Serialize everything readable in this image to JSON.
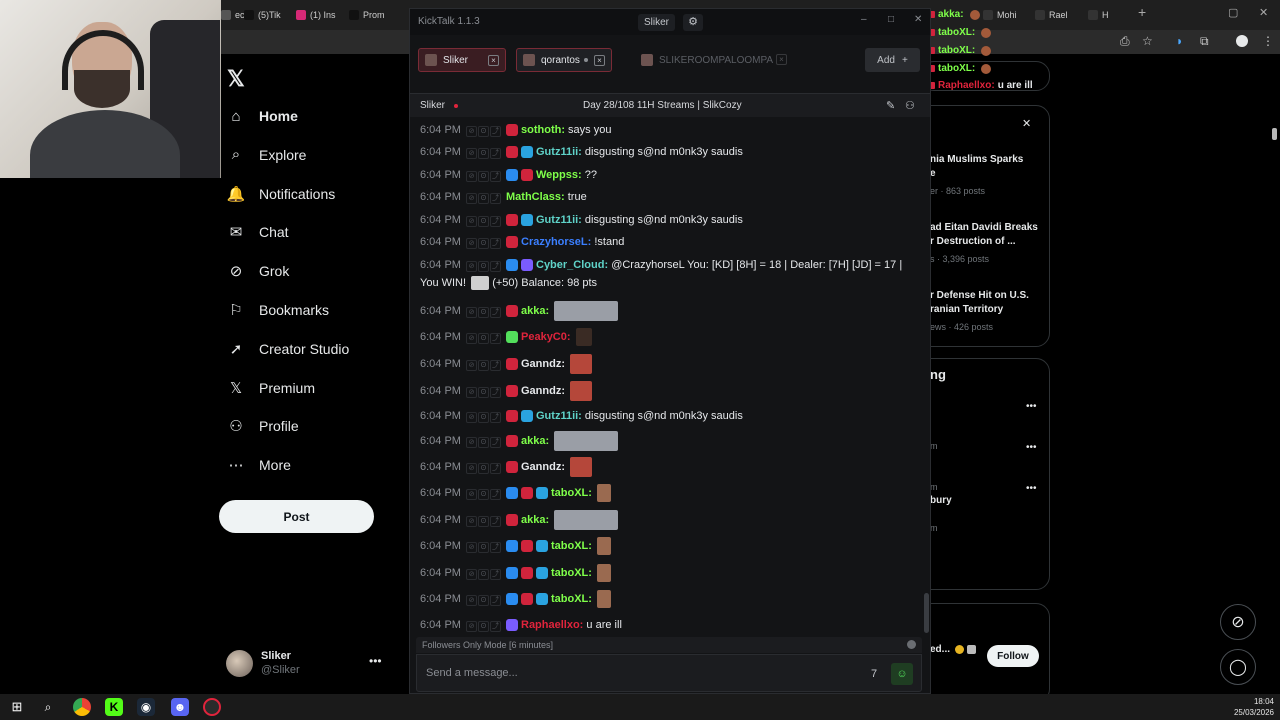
{
  "browser": {
    "tabs": [
      {
        "label": "ec",
        "color": "#555555"
      },
      {
        "label": "(5)Tik",
        "color": "#111111"
      },
      {
        "label": "(1) Ins",
        "color": "#d62976"
      },
      {
        "label": "Prom",
        "color": "#111111"
      },
      {
        "label": "Mohi",
        "color": "#333333"
      },
      {
        "label": "Rael",
        "color": "#333333"
      },
      {
        "label": "H",
        "color": "#333333"
      }
    ]
  },
  "x": {
    "nav": [
      {
        "label": "Home",
        "icon": "home-icon",
        "glyph": "⌂",
        "active": true
      },
      {
        "label": "Explore",
        "icon": "search-icon",
        "glyph": "⌕"
      },
      {
        "label": "Notifications",
        "icon": "bell-icon",
        "glyph": "🔔"
      },
      {
        "label": "Chat",
        "icon": "mail-icon",
        "glyph": "✉"
      },
      {
        "label": "Grok",
        "icon": "grok-icon",
        "glyph": "⊘"
      },
      {
        "label": "Bookmarks",
        "icon": "bookmark-icon",
        "glyph": "⚐"
      },
      {
        "label": "Creator Studio",
        "icon": "rocket-icon",
        "glyph": "➚"
      },
      {
        "label": "Premium",
        "icon": "x-logo-icon",
        "glyph": "𝕏"
      },
      {
        "label": "Profile",
        "icon": "person-icon",
        "glyph": "⚇"
      },
      {
        "label": "More",
        "icon": "more-circle-icon",
        "glyph": "⋯"
      }
    ],
    "post_label": "Post",
    "account": {
      "name": "Sliker",
      "handle": "@Sliker"
    },
    "news": [
      {
        "title": "nia Muslims Sparks",
        "title2": "e",
        "meta": "er · 863 posts"
      },
      {
        "title": "ad Eitan Davidi Breaks",
        "title2": "r Destruction of ...",
        "meta": "s · 3,396 posts"
      },
      {
        "title": "r Defense Hit on U.S.",
        "title2": "ranian Territory",
        "meta": "ews · 426 posts"
      }
    ],
    "trending_heading": "ng",
    "trend_items": [
      {
        "label": "m",
        "label2": ""
      },
      {
        "label": "m",
        "label2": "bury"
      },
      {
        "label": "m",
        "label2": ""
      }
    ],
    "suggestion": "ed...",
    "follow_label": "Follow",
    "close_glyph": "✕"
  },
  "overlay": [
    {
      "name": "akka:",
      "text": "",
      "color": "#7fff4a"
    },
    {
      "name": "taboXL:",
      "text": "",
      "color": "#7fff4a"
    },
    {
      "name": "taboXL:",
      "text": "",
      "color": "#7fff4a"
    },
    {
      "name": "taboXL:",
      "text": "",
      "color": "#7fff4a"
    },
    {
      "name": "Raphaellxo:",
      "text": "u are ill",
      "color": "#e0243c"
    }
  ],
  "kicktalk": {
    "app_title": "KickTalk 1.1.3",
    "user_button": "Sliker",
    "tabs": [
      {
        "label": "Sliker",
        "active": true,
        "live": false
      },
      {
        "label": "qorantos",
        "active": false,
        "live": true
      },
      {
        "label": "SLIKEROOMPALOOMPA",
        "active": false,
        "live": false,
        "dim": true
      }
    ],
    "add_label": "Add",
    "channel": "Sliker",
    "stream_title": "Day 28/108 11H Streams | SlikCozy",
    "messages": [
      {
        "time": "6:04 PM",
        "badges": [
          "#d0243c"
        ],
        "user": "sothoth:",
        "color": "#7fff4a",
        "text": "says you"
      },
      {
        "time": "6:04 PM",
        "badges": [
          "#d0243c",
          "#2aa3e0"
        ],
        "user": "Gutz11ii:",
        "color": "#5fd3c9",
        "text": "disgusting s@nd m0nk3y saudis"
      },
      {
        "time": "6:04 PM",
        "badges": [
          "#2a8cf0",
          "#d0243c"
        ],
        "user": "Weppss:",
        "color": "#7fff4a",
        "text": "??"
      },
      {
        "time": "6:04 PM",
        "badges": [],
        "user": "MathClass:",
        "color": "#7fff4a",
        "text": "true"
      },
      {
        "time": "6:04 PM",
        "badges": [
          "#d0243c",
          "#2aa3e0"
        ],
        "user": "Gutz11ii:",
        "color": "#5fd3c9",
        "text": "disgusting s@nd m0nk3y saudis"
      },
      {
        "time": "6:04 PM",
        "badges": [
          "#d0243c"
        ],
        "user": "CrazyhorseL:",
        "color": "#3b7fff",
        "text": "!stand"
      },
      {
        "time": "6:04 PM",
        "badges": [
          "#2a8cf0",
          "#7a5cff"
        ],
        "user": "Cyber_Cloud:",
        "color": "#5fd3c9",
        "text": "@CrazyhorseL You: [KD] [8H] = 18 | Dealer: [7H] [JD] = 17 | You WIN!",
        "text2": "(+50) Balance: 98 pts"
      },
      {
        "time": "6:04 PM",
        "badges": [
          "#d0243c"
        ],
        "user": "akka:",
        "color": "#7fff4a",
        "text": ""
      },
      {
        "time": "6:04 PM",
        "badges": [
          "#53e05c"
        ],
        "user": "PeakyC0:",
        "color": "#e0243c",
        "text": ""
      },
      {
        "time": "6:04 PM",
        "badges": [
          "#d0243c"
        ],
        "user": "Ganndz:",
        "color": "#e6e8eb",
        "text": ""
      },
      {
        "time": "6:04 PM",
        "badges": [
          "#d0243c"
        ],
        "user": "Ganndz:",
        "color": "#e6e8eb",
        "text": ""
      },
      {
        "time": "6:04 PM",
        "badges": [
          "#d0243c",
          "#2aa3e0"
        ],
        "user": "Gutz11ii:",
        "color": "#5fd3c9",
        "text": "disgusting s@nd m0nk3y saudis"
      },
      {
        "time": "6:04 PM",
        "badges": [
          "#d0243c"
        ],
        "user": "akka:",
        "color": "#7fff4a",
        "text": ""
      },
      {
        "time": "6:04 PM",
        "badges": [
          "#d0243c"
        ],
        "user": "Ganndz:",
        "color": "#e6e8eb",
        "text": ""
      },
      {
        "time": "6:04 PM",
        "badges": [
          "#2a8cf0",
          "#d0243c",
          "#2aa3e0"
        ],
        "user": "taboXL:",
        "color": "#7fff4a",
        "text": ""
      },
      {
        "time": "6:04 PM",
        "badges": [
          "#d0243c"
        ],
        "user": "akka:",
        "color": "#7fff4a",
        "text": ""
      },
      {
        "time": "6:04 PM",
        "badges": [
          "#2a8cf0",
          "#d0243c",
          "#2aa3e0"
        ],
        "user": "taboXL:",
        "color": "#7fff4a",
        "text": ""
      },
      {
        "time": "6:04 PM",
        "badges": [
          "#2a8cf0",
          "#d0243c",
          "#2aa3e0"
        ],
        "user": "taboXL:",
        "color": "#7fff4a",
        "text": ""
      },
      {
        "time": "6:04 PM",
        "badges": [
          "#2a8cf0",
          "#d0243c",
          "#2aa3e0"
        ],
        "user": "taboXL:",
        "color": "#7fff4a",
        "text": ""
      },
      {
        "time": "6:04 PM",
        "badges": [
          "#7a5cff"
        ],
        "user": "Raphaellxo:",
        "color": "#e0243c",
        "text": "u are ill"
      }
    ],
    "followers_mode": "Followers Only Mode [6 minutes]",
    "input_placeholder": "Send a message..."
  },
  "taskbar": {
    "time": "18:04",
    "date": "25/03/2026"
  }
}
